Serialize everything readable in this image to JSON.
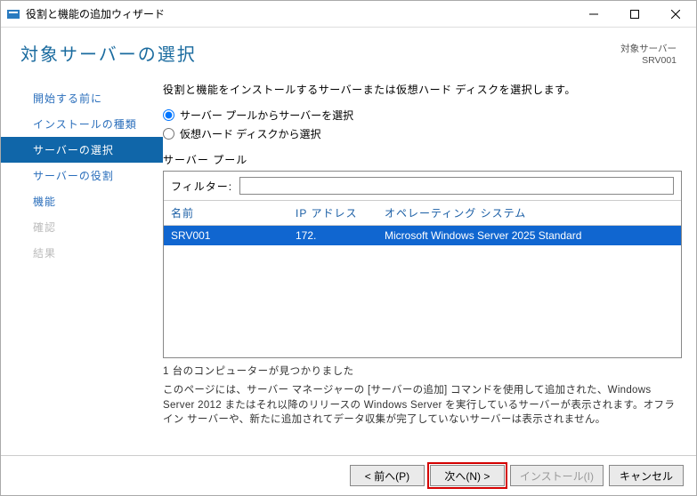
{
  "window": {
    "title": "役割と機能の追加ウィザード"
  },
  "header": {
    "page_title": "対象サーバーの選択",
    "target_label": "対象サーバー",
    "target_value": "SRV001"
  },
  "sidebar": {
    "items": [
      {
        "label": "開始する前に",
        "state": "normal"
      },
      {
        "label": "インストールの種類",
        "state": "normal"
      },
      {
        "label": "サーバーの選択",
        "state": "active"
      },
      {
        "label": "サーバーの役割",
        "state": "normal"
      },
      {
        "label": "機能",
        "state": "normal"
      },
      {
        "label": "確認",
        "state": "disabled"
      },
      {
        "label": "結果",
        "state": "disabled"
      }
    ]
  },
  "main": {
    "instruction": "役割と機能をインストールするサーバーまたは仮想ハード ディスクを選択します。",
    "radio1": "サーバー プールからサーバーを選択",
    "radio2": "仮想ハード ディスクから選択",
    "pool_label": "サーバー プール",
    "filter_label": "フィルター:",
    "filter_value": "",
    "columns": {
      "name": "名前",
      "ip": "IP アドレス",
      "os": "オペレーティング システム"
    },
    "row": {
      "name": "SRV001",
      "ip": "172.",
      "os": "Microsoft Windows Server 2025 Standard"
    },
    "count": "1 台のコンピューターが見つかりました",
    "description": "このページには、サーバー マネージャーの [サーバーの追加] コマンドを使用して追加された、Windows Server 2012 またはそれ以降のリリースの Windows Server を実行しているサーバーが表示されます。オフライン サーバーや、新たに追加されてデータ収集が完了していないサーバーは表示されません。"
  },
  "footer": {
    "prev": "< 前へ(P)",
    "next": "次へ(N) >",
    "install": "インストール(I)",
    "cancel": "キャンセル"
  }
}
